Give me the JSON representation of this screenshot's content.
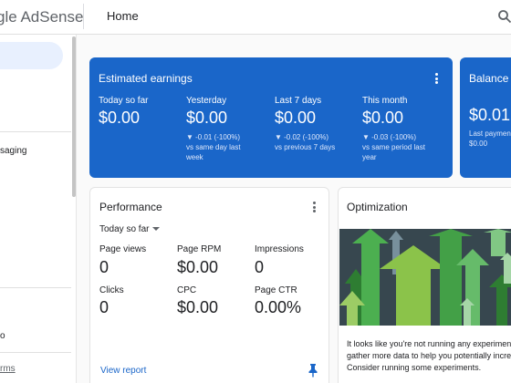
{
  "header": {
    "brand": "gle AdSense",
    "page_title": "Home"
  },
  "sidebar": {
    "messaging_label": "saging",
    "item_o_label": "o",
    "terms_link": "rms"
  },
  "estimated_earnings": {
    "title": "Estimated earnings",
    "metrics": [
      {
        "label": "Today so far",
        "value": "$0.00",
        "delta": "",
        "compare": ""
      },
      {
        "label": "Yesterday",
        "value": "$0.00",
        "delta": "▼ -0.01 (-100%)",
        "compare": "vs same day last week"
      },
      {
        "label": "Last 7 days",
        "value": "$0.00",
        "delta": "▼ -0.02 (-100%)",
        "compare": "vs previous 7 days"
      },
      {
        "label": "This month",
        "value": "$0.00",
        "delta": "▼ -0.03 (-100%)",
        "compare": "vs same period last year"
      }
    ]
  },
  "balance": {
    "title": "Balance",
    "value": "$0.01",
    "last_payment_label": "Last paymen",
    "last_payment_value": "$0.00"
  },
  "performance": {
    "title": "Performance",
    "range": "Today so far",
    "metrics": [
      {
        "label": "Page views",
        "value": "0"
      },
      {
        "label": "Page RPM",
        "value": "$0.00"
      },
      {
        "label": "Impressions",
        "value": "0"
      },
      {
        "label": "Clicks",
        "value": "0"
      },
      {
        "label": "CPC",
        "value": "$0.00"
      },
      {
        "label": "Page CTR",
        "value": "0.00%"
      }
    ],
    "view_report": "View report"
  },
  "optimization": {
    "title": "Optimization",
    "text_lines": [
      "It looks like you're not running any experiments",
      "gather more data to help you potentially increas",
      "Consider running some experiments."
    ]
  },
  "colors": {
    "accent_blue": "#1a66c9",
    "art_bg": "#37474f",
    "arrow_green": "#4caf50",
    "arrow_lime": "#9ccc65"
  },
  "icons": {
    "search": "search-icon",
    "kebab": "more-vert-icon",
    "pin": "pin-icon",
    "caret": "arrow-drop-down-icon"
  }
}
